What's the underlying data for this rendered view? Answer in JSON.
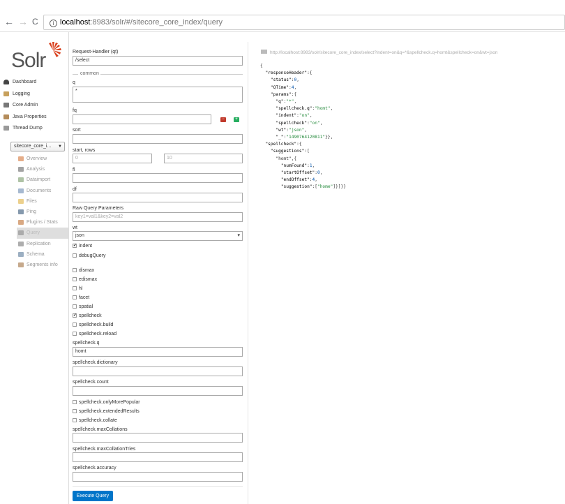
{
  "browser": {
    "back": "←",
    "forward": "→",
    "reload": "C",
    "url_host": "localhost",
    "url_rest": ":8983/solr/#/sitecore_core_index/query"
  },
  "logo": {
    "text": "Solr"
  },
  "menu": [
    {
      "label": "Dashboard",
      "icon": "dashboard-icon",
      "color": "#444444"
    },
    {
      "label": "Logging",
      "icon": "logging-icon",
      "color": "#c7a05c"
    },
    {
      "label": "Core Admin",
      "icon": "core-admin-icon",
      "color": "#777777"
    },
    {
      "label": "Java Properties",
      "icon": "java-icon",
      "color": "#b48c5a"
    },
    {
      "label": "Thread Dump",
      "icon": "thread-icon",
      "color": "#999999"
    }
  ],
  "core_selector": {
    "value": "sitecore_core_i..."
  },
  "submenu": [
    {
      "label": "Overview",
      "icon": "home-icon",
      "color": "#d4763a"
    },
    {
      "label": "Analysis",
      "icon": "funnel-icon",
      "color": "#666666"
    },
    {
      "label": "Dataimport",
      "icon": "import-icon",
      "color": "#7a9b6a"
    },
    {
      "label": "Documents",
      "icon": "documents-icon",
      "color": "#6a8ab0"
    },
    {
      "label": "Files",
      "icon": "folder-icon",
      "color": "#e0b040"
    },
    {
      "label": "Ping",
      "icon": "ping-icon",
      "color": "#335577"
    },
    {
      "label": "Plugins / Stats",
      "icon": "plugins-icon",
      "color": "#c07030"
    },
    {
      "label": "Query",
      "icon": "search-icon",
      "color": "#888888"
    },
    {
      "label": "Replication",
      "icon": "replication-icon",
      "color": "#777777"
    },
    {
      "label": "Schema",
      "icon": "schema-icon",
      "color": "#5a7a9a"
    },
    {
      "label": "Segments info",
      "icon": "segments-icon",
      "color": "#a07040"
    }
  ],
  "form": {
    "request_handler_label": "Request-Handler (qt)",
    "request_handler_value": "/select",
    "common_label": "common",
    "q_label": "q",
    "q_value": "*",
    "fq_label": "fq",
    "fq_value": "",
    "minus": "−",
    "plus": "+",
    "sort_label": "sort",
    "start_rows_label": "start, rows",
    "start_placeholder": "0",
    "rows_placeholder": "10",
    "fl_label": "fl",
    "df_label": "df",
    "raw_label": "Raw Query Parameters",
    "raw_placeholder": "key1=val1&key2=val2",
    "wt_label": "wt",
    "wt_value": "json",
    "wt_caret": "▾",
    "indent_label": "indent",
    "debug_label": "debugQuery",
    "dismax_label": "dismax",
    "edismax_label": "edismax",
    "hl_label": "hl",
    "facet_label": "facet",
    "spatial_label": "spatial",
    "spellcheck_label": "spellcheck",
    "spellcheck_build_label": "spellcheck.build",
    "spellcheck_reload_label": "spellcheck.reload",
    "spellcheck_q_label": "spellcheck.q",
    "spellcheck_q_value": "homt",
    "spellcheck_dictionary_label": "spellcheck.dictionary",
    "spellcheck_count_label": "spellcheck.count",
    "only_more_popular_label": "spellcheck.onlyMorePopular",
    "extended_results_label": "spellcheck.extendedResults",
    "collate_label": "spellcheck.collate",
    "max_collations_label": "spellcheck.maxCollations",
    "max_collation_tries_label": "spellcheck.maxCollationTries",
    "accuracy_label": "spellcheck.accuracy",
    "execute_label": "Execute Query",
    "check_mark": "✔"
  },
  "result": {
    "url": "http://localhost:8983/solr/sitecore_core_index/select?indent=on&q=*&spellcheck.q=homt&spellcheck=on&wt=json",
    "json_lines": [
      "{",
      "  \"responseHeader\":{",
      "    \"status\":0,",
      "    \"QTime\":4,",
      "    \"params\":{",
      "      \"q\":\"*\",",
      "      \"spellcheck.q\":\"homt\",",
      "      \"indent\":\"on\",",
      "      \"spellcheck\":\"on\",",
      "      \"wt\":\"json\",",
      "      \"_\":\"1490764120811\"}},",
      "  \"spellcheck\":{",
      "    \"suggestions\":[",
      "      \"homt\",{",
      "        \"numFound\":1,",
      "        \"startOffset\":0,",
      "        \"endOffset\":4,",
      "        \"suggestion\":[\"home\"]}]}}"
    ]
  }
}
